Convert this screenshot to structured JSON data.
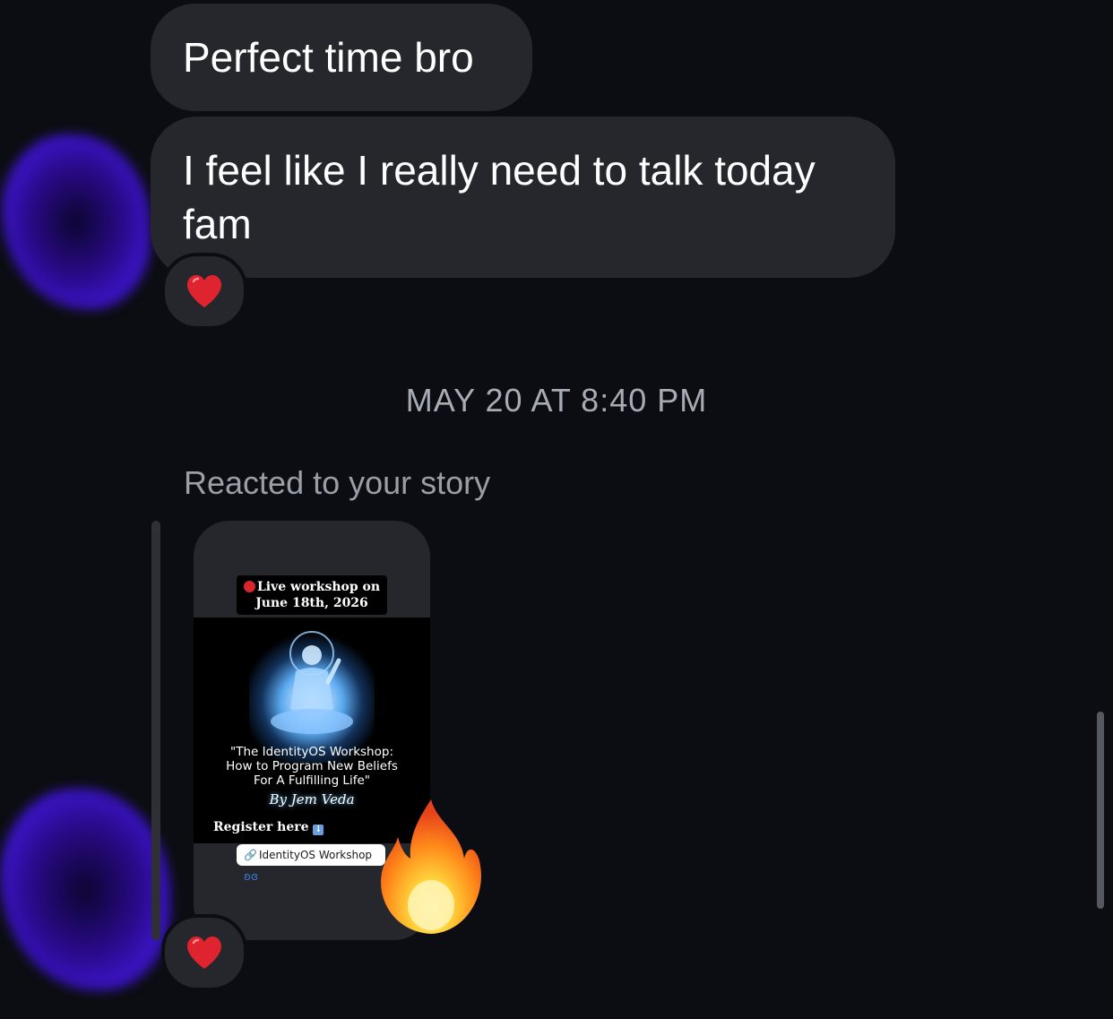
{
  "messages": [
    {
      "text": "Perfect time bro",
      "reaction": "heart"
    },
    {
      "text": "I feel like I really need to talk today fam",
      "reaction": "heart"
    }
  ],
  "timestamp": "MAY 20 AT 8:40 PM",
  "story_reply": {
    "label": "Reacted to your story",
    "story": {
      "live_banner": "Live workshop on June 18th, 2026",
      "live_line1": "Live workshop on",
      "live_line2": "June 18th, 2026",
      "quote_line1": "\"The IdentityOS Workshop:",
      "quote_line2": "How to Program New Beliefs",
      "quote_line3": "For A Fulfilling Life\"",
      "byline": "By Jem Veda",
      "register": "Register here",
      "link_sticker": "IdentityOS Workshop"
    },
    "emoji_reaction": "fire",
    "reaction": "heart"
  },
  "colors": {
    "background": "#0c0d12",
    "bubble": "#25272c",
    "meta_text": "#a7abb3",
    "heart": "#e0242f"
  },
  "icons": {
    "reaction_icon": "heart-icon",
    "story_reaction_icon": "fire-icon"
  }
}
